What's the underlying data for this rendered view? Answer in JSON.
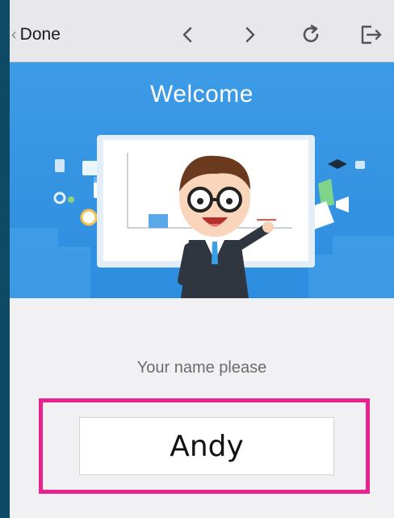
{
  "toolbar": {
    "done_label": "Done",
    "back_icon": "chevron-left-icon",
    "forward_icon": "chevron-right-icon",
    "reload_icon": "reload-icon",
    "exit_icon": "exit-icon"
  },
  "hero": {
    "title": "Welcome",
    "background_color": "#2d8ddf",
    "illustration": "teacher-presentation-illustration"
  },
  "form": {
    "prompt": "Your name please",
    "name_value": "Andy",
    "highlight_color": "#e8228f"
  }
}
